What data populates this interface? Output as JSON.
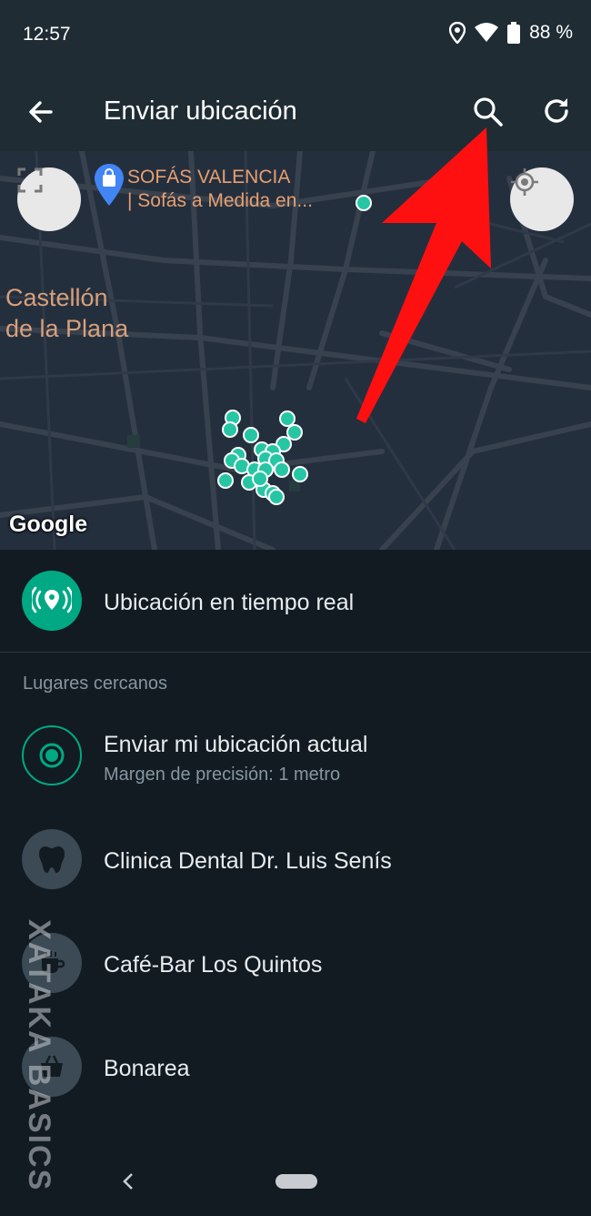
{
  "status_bar": {
    "time": "12:57",
    "battery": "88 %"
  },
  "app_bar": {
    "title": "Enviar ubicación",
    "back_icon": "arrow-left-icon",
    "search_icon": "search-icon",
    "refresh_icon": "refresh-icon"
  },
  "map": {
    "poi_name_line1": "SOFÁS VALENCIA",
    "poi_name_line2": "| Sofás a Medida en...",
    "city_line1": "Castellón",
    "city_line2": "de la Plana",
    "attribution": "Google",
    "accent": "#26c6a4",
    "annotation_arrow_color": "#ff1010"
  },
  "live_location": {
    "label": "Ubicación en tiempo real",
    "icon": "live-location-icon",
    "color": "#00a884"
  },
  "nearby": {
    "header": "Lugares cercanos",
    "current": {
      "title": "Enviar mi ubicación actual",
      "subtitle": "Margen de precisión: 1 metro"
    },
    "places": [
      {
        "name": "Clinica Dental Dr. Luis Senís",
        "icon": "tooth-icon"
      },
      {
        "name": "Café-Bar Los Quintos",
        "icon": "cafe-icon"
      },
      {
        "name": "Bonarea",
        "icon": "shopping-basket-icon"
      }
    ]
  },
  "watermark": "XATAKA BASICS"
}
